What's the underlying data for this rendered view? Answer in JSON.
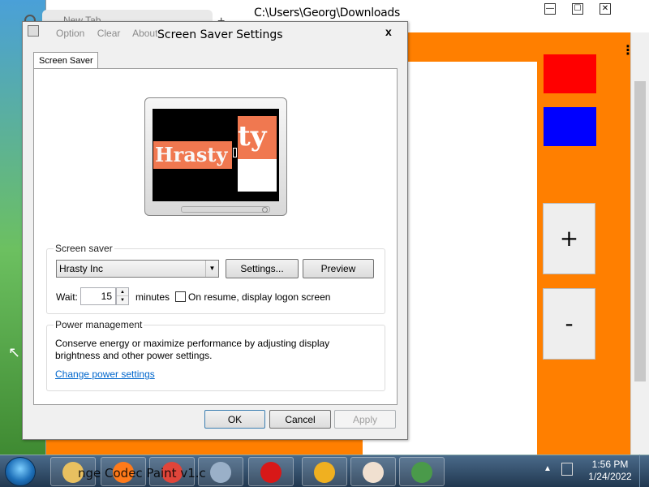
{
  "background_app": {
    "title": "C:\\Users\\Georg\\Downloads",
    "title_overlay": "Orange Codec Paint",
    "menu_glyph": "⋮",
    "plus_label": "+",
    "minus_label": "-",
    "colors": {
      "canvas_bg": "#ff7f00",
      "swatch_red": "#ff0000",
      "swatch_blue": "#0000ff"
    },
    "window_controls": {
      "minimize": "—",
      "maximize": "☐",
      "close": "✕"
    }
  },
  "chrome": {
    "tab_label": "New Tab",
    "new_tab_glyph": "+"
  },
  "dialog": {
    "title": "Screen Saver Settings",
    "close_glyph": "x",
    "menu_items": [
      "Option",
      "Clear",
      "About"
    ],
    "tab_label": "Screen Saver",
    "preview": {
      "text": "Hrasty",
      "block_text": "ty"
    },
    "screen_saver": {
      "group_label": "Screen saver",
      "selected": "Hrasty Inc",
      "dropdown_glyph": "▼",
      "settings_label": "Settings...",
      "preview_label": "Preview",
      "wait_label": "Wait:",
      "wait_value": "15",
      "spin_up": "▲",
      "spin_down": "▼",
      "minutes_label": "minutes",
      "logon_label": "On resume, display logon screen",
      "logon_checked": false
    },
    "power": {
      "group_label": "Power management",
      "description": "Conserve energy or maximize performance by adjusting display brightness and other power settings.",
      "link": "Change power settings"
    },
    "buttons": {
      "ok": "OK",
      "cancel": "Cancel",
      "apply": "Apply"
    }
  },
  "taskbar": {
    "ghost_text": "nge Codec Paint v1.c",
    "time": "1:56 PM",
    "date": "1/24/2022",
    "tray_arrow": "▲",
    "items": [
      {
        "name": "file-explorer",
        "color": "#e8c060"
      },
      {
        "name": "firefox",
        "color": "#ff7a1a"
      },
      {
        "name": "chrome",
        "color": "#e0453a"
      },
      {
        "name": "task-manager",
        "color": "#9ab0c8"
      },
      {
        "name": "01-app",
        "color": "#d81818"
      },
      {
        "name": "shield-app",
        "color": "#f0b020"
      },
      {
        "name": "paint-app",
        "color": "#f0e0d0"
      },
      {
        "name": "remote-desktop",
        "color": "#4a9a4a"
      }
    ]
  }
}
